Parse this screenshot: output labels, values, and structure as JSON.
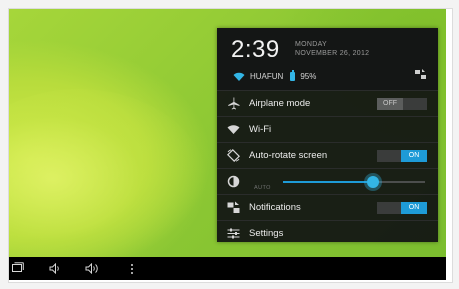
{
  "header": {
    "time": "2:39",
    "day": "MONDAY",
    "date": "NOVEMBER 26, 2012",
    "network_name": "HUAFUN",
    "battery_level": "95%"
  },
  "rows": {
    "airplane": {
      "label": "Airplane mode",
      "toggle": "OFF"
    },
    "wifi": {
      "label": "Wi-Fi"
    },
    "rotate": {
      "label": "Auto-rotate screen",
      "toggle": "ON"
    },
    "brightness": {
      "auto_label": "AUTO",
      "level": 0.65
    },
    "notifications": {
      "label": "Notifications",
      "toggle": "ON"
    },
    "settings": {
      "label": "Settings"
    }
  },
  "colors": {
    "accent": "#33b5e5",
    "toggle_on": "#1e9bd7",
    "panel_bg": "#141615"
  },
  "navbar": {
    "icons": [
      "recent-apps-icon",
      "volume-down-icon",
      "volume-up-icon",
      "menu-icon"
    ]
  }
}
